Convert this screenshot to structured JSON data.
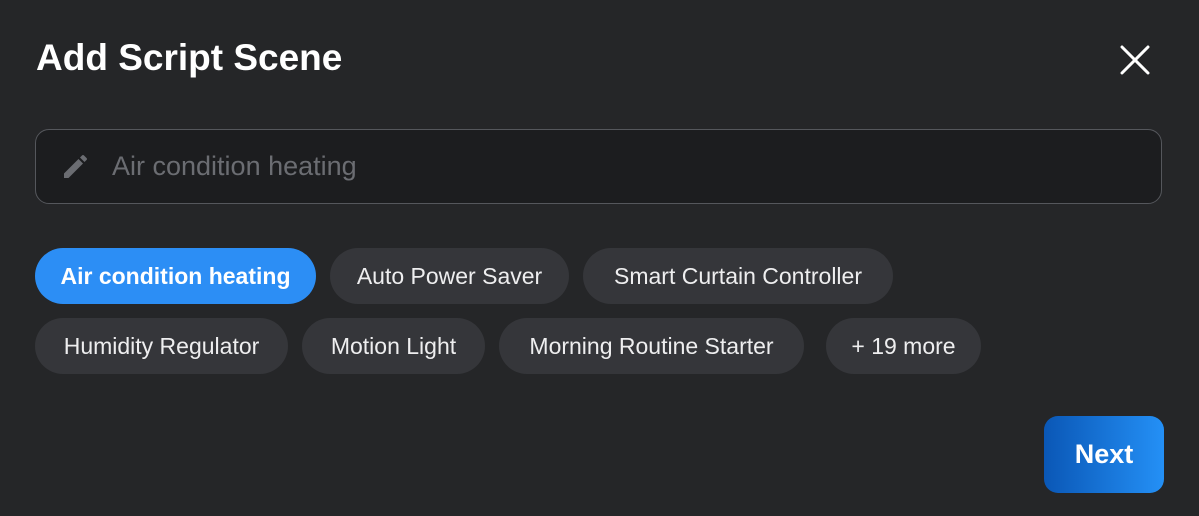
{
  "dialog": {
    "title": "Add Script Scene"
  },
  "input": {
    "placeholder": "Air condition heating",
    "value": ""
  },
  "chips": [
    {
      "label": "Air condition heating",
      "active": true
    },
    {
      "label": "Auto Power Saver",
      "active": false
    },
    {
      "label": "Smart Curtain Controller",
      "active": false
    },
    {
      "label": "Humidity Regulator",
      "active": false
    },
    {
      "label": "Motion Light",
      "active": false
    },
    {
      "label": "Morning Routine Starter",
      "active": false
    },
    {
      "label": "+ 19 more",
      "active": false
    }
  ],
  "actions": {
    "next_label": "Next"
  },
  "icons": {
    "close": "close-icon",
    "edit": "pencil-icon"
  },
  "colors": {
    "background": "#252628",
    "accent": "#2c8ef5",
    "chip": "#35363a"
  }
}
